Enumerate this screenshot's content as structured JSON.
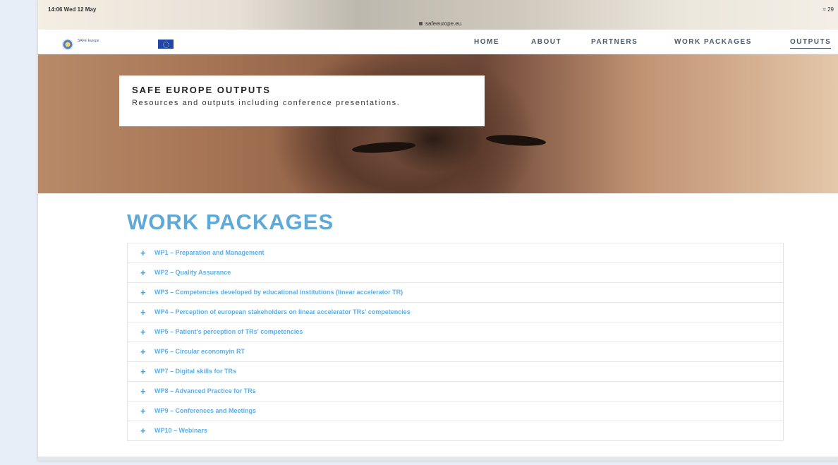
{
  "status_bar": {
    "time": "14:06  Wed 12 May",
    "url": "safeeurope.eu",
    "battery": "29"
  },
  "navbar": {
    "logo_text": "SAFE Europe",
    "items": [
      {
        "label": "HOME",
        "active": false
      },
      {
        "label": "ABOUT",
        "active": false
      },
      {
        "label": "PARTNERS",
        "active": false
      },
      {
        "label": "WORK PACKAGES",
        "active": false
      },
      {
        "label": "OUTPUTS",
        "active": true
      }
    ]
  },
  "hero": {
    "title": "SAFE EUROPE OUTPUTS",
    "subtitle": "Resources and outputs including conference presentations."
  },
  "main": {
    "heading": "WORK PACKAGES",
    "work_packages": [
      "WP1 – Preparation and Management",
      "WP2 – Quality Assurance",
      "WP3 – Competencies developed by educational institutions (linear accelerator TR)",
      "WP4 – Perception of european stakeholders on linear accelerator TRs' competencies",
      "WP5 – Patient's perception of TRs' competencies",
      "WP6 – Circular economyin RT",
      "WP7 – Digital skills for TRs",
      "WP8 – Advanced Practice for TRs",
      "WP9 – Conferences and Meetings",
      "WP10 – Webinars"
    ]
  },
  "colors": {
    "accent": "#5fa9d6",
    "link": "#62ade0",
    "nav_text": "#4a5a6e"
  }
}
